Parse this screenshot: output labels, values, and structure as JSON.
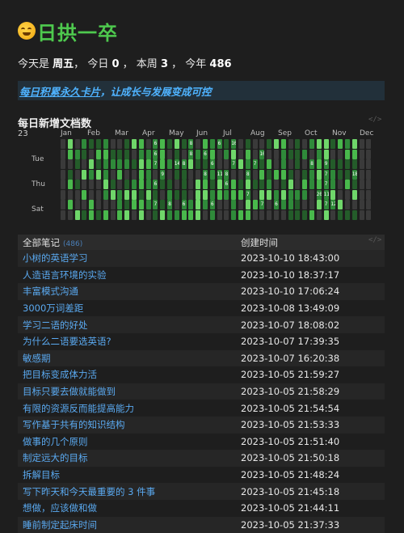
{
  "title": "日拱一卒",
  "stats": {
    "today_label": "今天是",
    "weekday": "周五",
    "today_count_label": "今日",
    "today_count": "0",
    "week_label": "本周",
    "week_count": "3",
    "year_label": "今年",
    "year_count": "486"
  },
  "banner": {
    "link_text": "每日积累永久卡片",
    "rest_text": "，让成长与发展变成可控"
  },
  "heatmap": {
    "title": "每日新增文档数",
    "year": "23",
    "months": [
      "Jan",
      "Feb",
      "Mar",
      "Apr",
      "May",
      "Jun",
      "Jul",
      "Aug",
      "Sep",
      "Oct",
      "Nov",
      "Dec"
    ],
    "days": [
      "Tue",
      "Thu",
      "Sat"
    ],
    "colors": {
      "empty": "#3a3a3a",
      "l1": "#245c2a",
      "l2": "#2f8a3a",
      "l3": "#49b84c",
      "l4": "#6fd66a"
    },
    "labels": [
      {
        "week": 13,
        "day": 0,
        "text": "6"
      },
      {
        "week": 18,
        "day": 0,
        "text": "8"
      },
      {
        "week": 22,
        "day": 0,
        "text": "6"
      },
      {
        "week": 24,
        "day": 0,
        "text": "10"
      },
      {
        "week": 13,
        "day": 2,
        "text": "6"
      },
      {
        "week": 18,
        "day": 2,
        "text": "8"
      },
      {
        "week": 20,
        "day": 2,
        "text": "6"
      },
      {
        "week": 28,
        "day": 2,
        "text": "10"
      },
      {
        "week": 13,
        "day": 4,
        "text": "7"
      },
      {
        "week": 16,
        "day": 4,
        "text": "14"
      },
      {
        "week": 17,
        "day": 4,
        "text": "8"
      },
      {
        "week": 21,
        "day": 4,
        "text": "6"
      },
      {
        "week": 24,
        "day": 4,
        "text": "7"
      },
      {
        "week": 27,
        "day": 4,
        "text": "7"
      },
      {
        "week": 35,
        "day": 4,
        "text": "8"
      },
      {
        "week": 37,
        "day": 4,
        "text": "9"
      },
      {
        "week": 14,
        "day": 6,
        "text": "9"
      },
      {
        "week": 20,
        "day": 6,
        "text": "8"
      },
      {
        "week": 22,
        "day": 6,
        "text": "11"
      },
      {
        "week": 23,
        "day": 6,
        "text": "8"
      },
      {
        "week": 26,
        "day": 6,
        "text": "8"
      },
      {
        "week": 37,
        "day": 6,
        "text": "7"
      },
      {
        "week": 41,
        "day": 6,
        "text": "18"
      },
      {
        "week": 13,
        "day": 8,
        "text": "6"
      },
      {
        "week": 23,
        "day": 8,
        "text": "6"
      },
      {
        "week": 37,
        "day": 8,
        "text": "7"
      },
      {
        "week": 26,
        "day": 10,
        "text": "7"
      },
      {
        "week": 36,
        "day": 10,
        "text": "20"
      },
      {
        "week": 37,
        "day": 10,
        "text": "11"
      },
      {
        "week": 13,
        "day": 12,
        "text": "7"
      },
      {
        "week": 15,
        "day": 12,
        "text": "8"
      },
      {
        "week": 17,
        "day": 12,
        "text": "6"
      },
      {
        "week": 21,
        "day": 12,
        "text": "6"
      },
      {
        "week": 28,
        "day": 12,
        "text": "7"
      },
      {
        "week": 30,
        "day": 12,
        "text": "6"
      },
      {
        "week": 37,
        "day": 12,
        "text": "7"
      },
      {
        "week": 38,
        "day": 12,
        "text": "12"
      }
    ]
  },
  "table": {
    "col1_label": "全部笔记",
    "count": "(486)",
    "col2_label": "创建时间",
    "rows": [
      {
        "title": "小树的英语学习",
        "time": "2023-10-10 18:43:00"
      },
      {
        "title": "人造语言环境的实验",
        "time": "2023-10-10 18:37:17"
      },
      {
        "title": "丰富模式沟通",
        "time": "2023-10-10 17:06:24"
      },
      {
        "title": "3000万词差距",
        "time": "2023-10-08 13:49:09"
      },
      {
        "title": "学习二语的好处",
        "time": "2023-10-07 18:08:02"
      },
      {
        "title": "为什么二语要选英语?",
        "time": "2023-10-07 17:39:35"
      },
      {
        "title": "敏感期",
        "time": "2023-10-07 16:20:38"
      },
      {
        "title": "把目标变成体力活",
        "time": "2023-10-05 21:59:27"
      },
      {
        "title": "目标只要去做就能做到",
        "time": "2023-10-05 21:58:29"
      },
      {
        "title": "有限的资源反而能提高能力",
        "time": "2023-10-05 21:54:54"
      },
      {
        "title": "写作基于共有的知识结构",
        "time": "2023-10-05 21:53:33"
      },
      {
        "title": "做事的几个原则",
        "time": "2023-10-05 21:51:40"
      },
      {
        "title": "制定远大的目标",
        "time": "2023-10-05 21:50:18"
      },
      {
        "title": "拆解目标",
        "time": "2023-10-05 21:48:24"
      },
      {
        "title": "写下昨天和今天最重要的 3 件事",
        "time": "2023-10-05 21:45:18"
      },
      {
        "title": "想做，应该做和做",
        "time": "2023-10-05 21:44:11"
      },
      {
        "title": "睡前制定起床时间",
        "time": "2023-10-05 21:37:33"
      }
    ]
  }
}
